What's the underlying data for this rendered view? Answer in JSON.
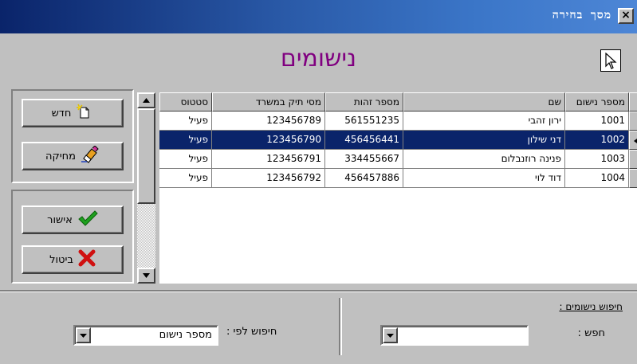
{
  "window": {
    "title": "מסך בחירה",
    "close_label": "×"
  },
  "header": {
    "page_title": "נישומים"
  },
  "buttons": {
    "new_label": "חדש",
    "delete_label": "מחיקה",
    "ok_label": "אישור",
    "cancel_label": "ביטול"
  },
  "grid": {
    "columns": [
      "מספר נישום",
      "שם",
      "מספר זהות",
      "מסי תיק במשרד",
      "סטטוס"
    ],
    "rows": [
      {
        "reg_no": "1001",
        "name": "ירון זהבי",
        "id_no": "561551235",
        "file_no": "123456789",
        "status": "פעיל"
      },
      {
        "reg_no": "1002",
        "name": "דני שילון",
        "id_no": "456456441",
        "file_no": "123456790",
        "status": "פעיל"
      },
      {
        "reg_no": "1003",
        "name": "פנינה רוזנבלום",
        "id_no": "334455667",
        "file_no": "123456791",
        "status": "פעיל"
      },
      {
        "reg_no": "1004",
        "name": "דוד לוי",
        "id_no": "456457886",
        "file_no": "123456792",
        "status": "פעיל"
      }
    ],
    "selected_row": 1
  },
  "search": {
    "title": "חיפוש נישומים :",
    "find_label": "חפש :",
    "find_value": "",
    "sort_label": "חיפוש לפי :",
    "sort_value": "מספר נישום"
  },
  "colors": {
    "title_bar": "#0a246a",
    "page_title": "#800080",
    "selection": "#0a246a",
    "face": "#c0c0c0"
  },
  "icons": {
    "new": "new-document-icon",
    "delete": "eraser-icon",
    "ok": "checkmark-icon",
    "cancel": "x-icon",
    "pointer": "cursor-icon"
  }
}
